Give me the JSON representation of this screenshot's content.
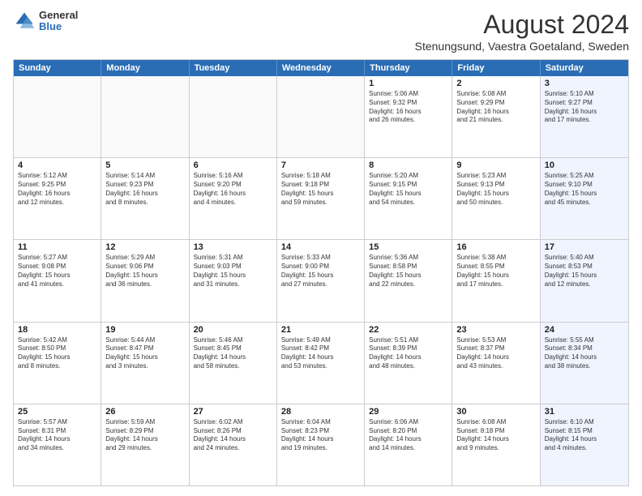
{
  "logo": {
    "general": "General",
    "blue": "Blue"
  },
  "header": {
    "month_year": "August 2024",
    "location": "Stenungsund, Vaestra Goetaland, Sweden"
  },
  "weekdays": [
    "Sunday",
    "Monday",
    "Tuesday",
    "Wednesday",
    "Thursday",
    "Friday",
    "Saturday"
  ],
  "rows": [
    [
      {
        "day": "",
        "info": "",
        "empty": true
      },
      {
        "day": "",
        "info": "",
        "empty": true
      },
      {
        "day": "",
        "info": "",
        "empty": true
      },
      {
        "day": "",
        "info": "",
        "empty": true
      },
      {
        "day": "1",
        "info": "Sunrise: 5:06 AM\nSunset: 9:32 PM\nDaylight: 16 hours\nand 26 minutes."
      },
      {
        "day": "2",
        "info": "Sunrise: 5:08 AM\nSunset: 9:29 PM\nDaylight: 16 hours\nand 21 minutes."
      },
      {
        "day": "3",
        "info": "Sunrise: 5:10 AM\nSunset: 9:27 PM\nDaylight: 16 hours\nand 17 minutes.",
        "saturday": true
      }
    ],
    [
      {
        "day": "4",
        "info": "Sunrise: 5:12 AM\nSunset: 9:25 PM\nDaylight: 16 hours\nand 12 minutes."
      },
      {
        "day": "5",
        "info": "Sunrise: 5:14 AM\nSunset: 9:23 PM\nDaylight: 16 hours\nand 8 minutes."
      },
      {
        "day": "6",
        "info": "Sunrise: 5:16 AM\nSunset: 9:20 PM\nDaylight: 16 hours\nand 4 minutes."
      },
      {
        "day": "7",
        "info": "Sunrise: 5:18 AM\nSunset: 9:18 PM\nDaylight: 15 hours\nand 59 minutes."
      },
      {
        "day": "8",
        "info": "Sunrise: 5:20 AM\nSunset: 9:15 PM\nDaylight: 15 hours\nand 54 minutes."
      },
      {
        "day": "9",
        "info": "Sunrise: 5:23 AM\nSunset: 9:13 PM\nDaylight: 15 hours\nand 50 minutes."
      },
      {
        "day": "10",
        "info": "Sunrise: 5:25 AM\nSunset: 9:10 PM\nDaylight: 15 hours\nand 45 minutes.",
        "saturday": true
      }
    ],
    [
      {
        "day": "11",
        "info": "Sunrise: 5:27 AM\nSunset: 9:08 PM\nDaylight: 15 hours\nand 41 minutes."
      },
      {
        "day": "12",
        "info": "Sunrise: 5:29 AM\nSunset: 9:06 PM\nDaylight: 15 hours\nand 36 minutes."
      },
      {
        "day": "13",
        "info": "Sunrise: 5:31 AM\nSunset: 9:03 PM\nDaylight: 15 hours\nand 31 minutes."
      },
      {
        "day": "14",
        "info": "Sunrise: 5:33 AM\nSunset: 9:00 PM\nDaylight: 15 hours\nand 27 minutes."
      },
      {
        "day": "15",
        "info": "Sunrise: 5:36 AM\nSunset: 8:58 PM\nDaylight: 15 hours\nand 22 minutes."
      },
      {
        "day": "16",
        "info": "Sunrise: 5:38 AM\nSunset: 8:55 PM\nDaylight: 15 hours\nand 17 minutes."
      },
      {
        "day": "17",
        "info": "Sunrise: 5:40 AM\nSunset: 8:53 PM\nDaylight: 15 hours\nand 12 minutes.",
        "saturday": true
      }
    ],
    [
      {
        "day": "18",
        "info": "Sunrise: 5:42 AM\nSunset: 8:50 PM\nDaylight: 15 hours\nand 8 minutes."
      },
      {
        "day": "19",
        "info": "Sunrise: 5:44 AM\nSunset: 8:47 PM\nDaylight: 15 hours\nand 3 minutes."
      },
      {
        "day": "20",
        "info": "Sunrise: 5:46 AM\nSunset: 8:45 PM\nDaylight: 14 hours\nand 58 minutes."
      },
      {
        "day": "21",
        "info": "Sunrise: 5:49 AM\nSunset: 8:42 PM\nDaylight: 14 hours\nand 53 minutes."
      },
      {
        "day": "22",
        "info": "Sunrise: 5:51 AM\nSunset: 8:39 PM\nDaylight: 14 hours\nand 48 minutes."
      },
      {
        "day": "23",
        "info": "Sunrise: 5:53 AM\nSunset: 8:37 PM\nDaylight: 14 hours\nand 43 minutes."
      },
      {
        "day": "24",
        "info": "Sunrise: 5:55 AM\nSunset: 8:34 PM\nDaylight: 14 hours\nand 38 minutes.",
        "saturday": true
      }
    ],
    [
      {
        "day": "25",
        "info": "Sunrise: 5:57 AM\nSunset: 8:31 PM\nDaylight: 14 hours\nand 34 minutes."
      },
      {
        "day": "26",
        "info": "Sunrise: 5:59 AM\nSunset: 8:29 PM\nDaylight: 14 hours\nand 29 minutes."
      },
      {
        "day": "27",
        "info": "Sunrise: 6:02 AM\nSunset: 8:26 PM\nDaylight: 14 hours\nand 24 minutes."
      },
      {
        "day": "28",
        "info": "Sunrise: 6:04 AM\nSunset: 8:23 PM\nDaylight: 14 hours\nand 19 minutes."
      },
      {
        "day": "29",
        "info": "Sunrise: 6:06 AM\nSunset: 8:20 PM\nDaylight: 14 hours\nand 14 minutes."
      },
      {
        "day": "30",
        "info": "Sunrise: 6:08 AM\nSunset: 8:18 PM\nDaylight: 14 hours\nand 9 minutes."
      },
      {
        "day": "31",
        "info": "Sunrise: 6:10 AM\nSunset: 8:15 PM\nDaylight: 14 hours\nand 4 minutes.",
        "saturday": true
      }
    ]
  ]
}
